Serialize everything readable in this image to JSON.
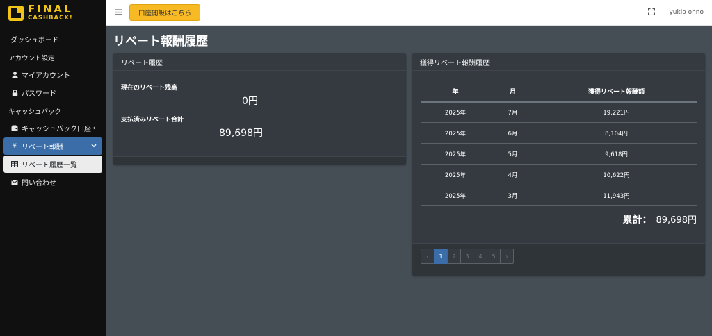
{
  "brand": {
    "line1": "FINAL",
    "line2": "CASHBACK!"
  },
  "sidebar": {
    "items": [
      {
        "label": "ダッシュボード"
      },
      {
        "label": "アカウント設定"
      },
      {
        "label": "マイアカウント"
      },
      {
        "label": "パスワード"
      },
      {
        "label": "キャッシュバック"
      },
      {
        "label": "キャッシュバック口座"
      },
      {
        "label": "リベート報酬"
      },
      {
        "label": "リベート履歴一覧"
      },
      {
        "label": "問い合わせ"
      }
    ]
  },
  "topbar": {
    "open_account_label": "口座開設はこちら",
    "user_name": "yukio ohno"
  },
  "page": {
    "title": "リベート報酬履歴"
  },
  "rebate_card": {
    "title": "リベート履歴",
    "balance_label": "現在のリベート残高",
    "balance_value": "0円",
    "paid_label": "支払済みリベート合計",
    "paid_value": "89,698円"
  },
  "history_card": {
    "title": "獲得リベート報酬履歴",
    "columns": [
      "年",
      "月",
      "獲得リベート報酬額"
    ],
    "rows": [
      {
        "year": "2025年",
        "month": "7月",
        "amount": "19,221円"
      },
      {
        "year": "2025年",
        "month": "6月",
        "amount": "8,104円"
      },
      {
        "year": "2025年",
        "month": "5月",
        "amount": "9,618円"
      },
      {
        "year": "2025年",
        "month": "4月",
        "amount": "10,622円"
      },
      {
        "year": "2025年",
        "month": "3月",
        "amount": "11,943円"
      }
    ],
    "total_label": "累計：",
    "total_value": "89,698円"
  },
  "pagination": {
    "prev": "‹",
    "pages": [
      "1",
      "2",
      "3",
      "4",
      "5"
    ],
    "next": "›",
    "current": "1"
  },
  "colors": {
    "accent": "#3b6ea8",
    "brand": "#f0c419",
    "button": "#f7b924",
    "content_bg": "#454d55",
    "card_bg": "#343a40"
  }
}
